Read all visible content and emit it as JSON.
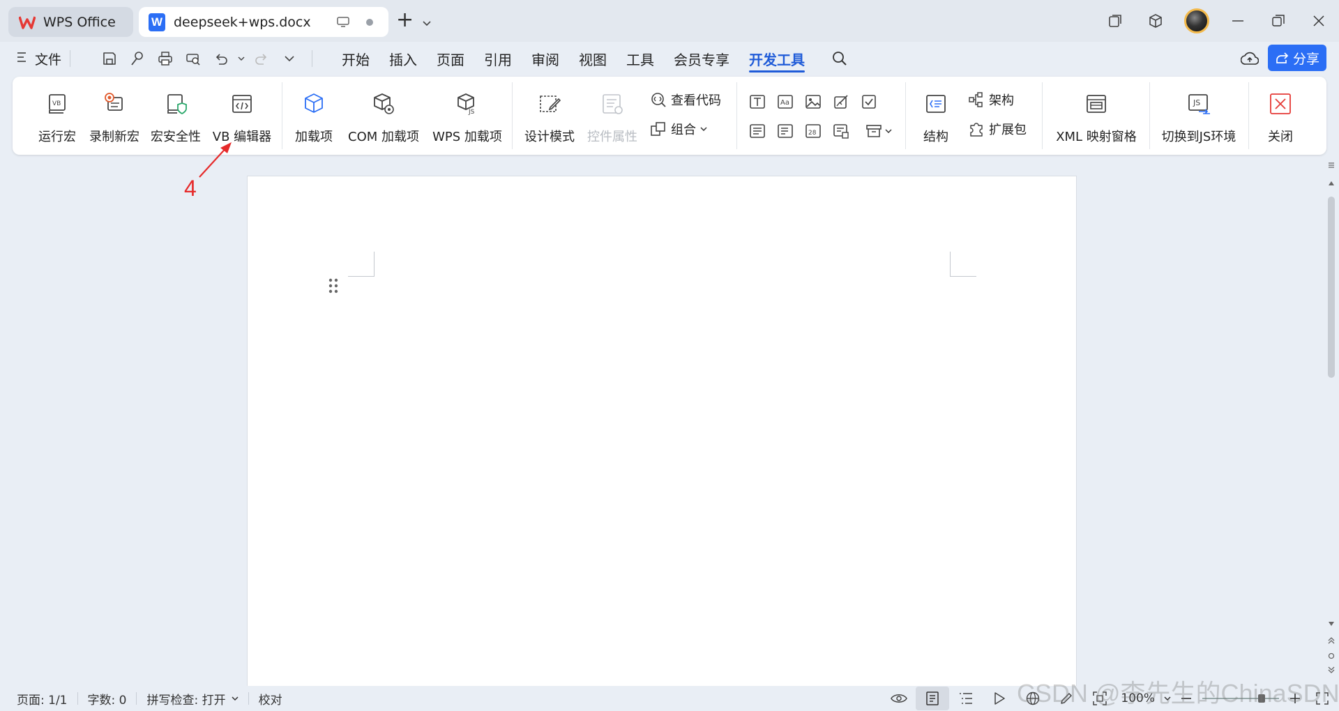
{
  "titlebar": {
    "tabs": [
      {
        "label": "WPS Office"
      },
      {
        "label": "deepseek+wps.docx"
      }
    ],
    "doc_icon_letter": "W",
    "new_tab_symbol": "+"
  },
  "menubar": {
    "file_label": "文件",
    "tabs": [
      "开始",
      "插入",
      "页面",
      "引用",
      "审阅",
      "视图",
      "工具",
      "会员专享",
      "开发工具"
    ],
    "active_tab": "开发工具",
    "share_label": "分享"
  },
  "ribbon": {
    "macro": [
      {
        "label": "运行宏",
        "icon": "run-macro-icon"
      },
      {
        "label": "录制新宏",
        "icon": "record-macro-icon"
      },
      {
        "label": "宏安全性",
        "icon": "macro-security-icon"
      },
      {
        "label": "VB 编辑器",
        "icon": "vb-editor-icon"
      }
    ],
    "addins": [
      {
        "label": "加载项",
        "icon": "addin-icon"
      },
      {
        "label": "COM 加载项",
        "icon": "com-addin-icon"
      },
      {
        "label": "WPS 加载项",
        "icon": "wps-addin-icon"
      }
    ],
    "controls": {
      "design_mode": "设计模式",
      "control_props": "控件属性",
      "view_code": "查看代码",
      "group": "组合"
    },
    "xml": {
      "structure": "结构",
      "schema": "架构",
      "expansion": "扩展包",
      "xml_pane": "XML 映射窗格"
    },
    "js_switch": "切换到JS环境",
    "close": "关闭"
  },
  "annotation": {
    "number": "4",
    "color": "#e62a2a"
  },
  "statusbar": {
    "page": "页面: 1/1",
    "word_count": "字数: 0",
    "spell_check": "拼写检查: 打开",
    "proofread": "校对",
    "zoom": "100%"
  },
  "watermark": "CSDN @李先生的ChinaSDN",
  "colors": {
    "accent": "#1f5bd8",
    "share_bg": "#2b6ef5",
    "wps_red": "#e53935"
  }
}
